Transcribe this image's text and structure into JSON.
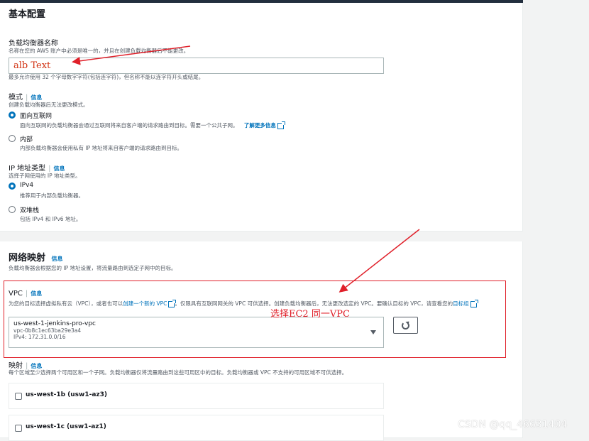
{
  "basic": {
    "title": "基本配置",
    "name_label": "负载均衡器名称",
    "name_desc": "名称在您的 AWS 账户中必须是唯一的，并且在创建负载均衡器后不能更改。",
    "name_value": "alb Text",
    "name_hint": "最多允许使用 32 个字母数字字符(包括连字符)，但名称不能以连字符开头或结尾。",
    "scheme_label": "模式",
    "info": "信息",
    "scheme_desc": "创建负载均衡器后无法更改模式。",
    "scheme_internet_label": "面向互联网",
    "scheme_internet_desc": "面向互联网的负载均衡器会通过互联网将来自客户端的请求路由到目标。需要一个公共子网。",
    "learn_more": "了解更多信息",
    "scheme_internal_label": "内部",
    "scheme_internal_desc": "内部负载均衡器会使用私有 IP 地址将来自客户端的请求路由到目标。",
    "ip_label": "IP 地址类型",
    "ip_desc": "选择子网使用的 IP 地址类型。",
    "ipv4_label": "IPv4",
    "ipv4_desc": "推荐用于内部负载均衡器。",
    "dualstack_label": "双堆栈",
    "dualstack_desc": "包括 IPv4 和 IPv6 地址。"
  },
  "network": {
    "title": "网络映射",
    "info": "信息",
    "desc": "负载均衡器会根据您的 IP 地址设置，将流量路由到选定子网中的目标。",
    "vpc_label": "VPC",
    "vpc_desc_a": "为您的目标选择虚拟私有云（VPC），或者也可以",
    "vpc_create_link": "创建一个新的 VPC",
    "vpc_desc_b": "。仅限具有互联网网关的 VPC 可供选择。创建负载均衡器后，无法更改选定的 VPC。要确认目标的 VPC，请查看您的",
    "vpc_target_link": "目标组",
    "vpc_name": "us-west-1-jenkins-pro-vpc",
    "vpc_id": "vpc-0b8c1ec63ba29e3a4",
    "vpc_cidr": "IPv4: 172.31.0.0/16",
    "mapping_label": "映射",
    "mapping_desc": "每个区域至少选择两个可用区和一个子网。负载均衡器仅将流量路由到这些可用区中的目标。负载均衡器或 VPC 不支持的可用区域不可供选择。",
    "az1": "us-west-1b (usw1-az3)",
    "az2": "us-west-1c (usw1-az1)"
  },
  "annotation": "选择EC2 同一VPC",
  "watermark": "CSDN @qq_46631404",
  "colors": {
    "accent": "#0073bb",
    "annotation_red": "#e0202a",
    "header": "#232f3e"
  }
}
